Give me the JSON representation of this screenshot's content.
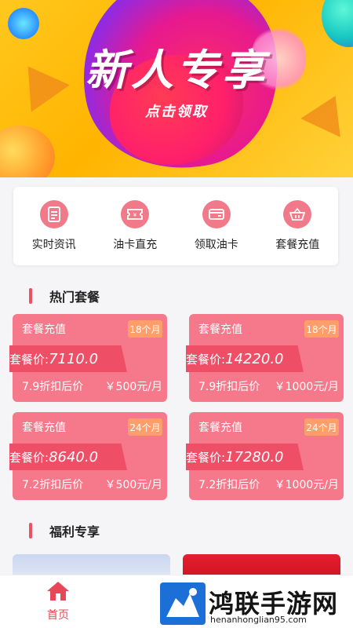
{
  "banner": {
    "title": "新人专享",
    "subtitle": "点击领取"
  },
  "quick_nav": [
    {
      "label": "实时资讯",
      "icon": "document-icon"
    },
    {
      "label": "油卡直充",
      "icon": "ticket-icon"
    },
    {
      "label": "领取油卡",
      "icon": "card-icon"
    },
    {
      "label": "套餐充值",
      "icon": "basket-icon"
    }
  ],
  "hot": {
    "title": "热门套餐",
    "packages": [
      {
        "name": "套餐充值",
        "tag": "18个月",
        "price_label": "套餐价:",
        "price": "7110.0",
        "discount": "7.9折扣后价",
        "monthly": "￥500元/月"
      },
      {
        "name": "套餐充值",
        "tag": "18个月",
        "price_label": "套餐价:",
        "price": "14220.0",
        "discount": "7.9折扣后价",
        "monthly": "￥1000元/月"
      },
      {
        "name": "套餐充值",
        "tag": "24个月",
        "price_label": "套餐价:",
        "price": "8640.0",
        "discount": "7.2折扣后价",
        "monthly": "￥500元/月"
      },
      {
        "name": "套餐充值",
        "tag": "24个月",
        "price_label": "套餐价:",
        "price": "17280.0",
        "discount": "7.2折扣后价",
        "monthly": "￥1000元/月"
      }
    ]
  },
  "welfare": {
    "title": "福利专享"
  },
  "tabbar": {
    "home_label": "首页"
  },
  "watermark": {
    "title": "鸿联手游网",
    "url": "henanhonglian95.com"
  },
  "colors": {
    "accent": "#ee4f61",
    "card": "#f6798b",
    "tag": "#ff9e6a",
    "banner": "#ffc81e"
  }
}
